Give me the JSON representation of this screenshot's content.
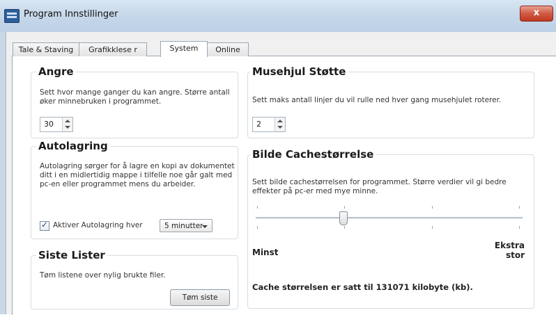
{
  "window": {
    "title": "Program Innstillinger",
    "close_label": "x"
  },
  "tabs": [
    {
      "label": "Tale & Staving"
    },
    {
      "label": "Grafikklese r"
    },
    {
      "label": "System"
    },
    {
      "label": "Online"
    }
  ],
  "active_tab": "System",
  "undo": {
    "title": "Angre",
    "description": "Sett hvor mange ganger du kan angre. Større antall øker minnebruken i programmet.",
    "value": "30"
  },
  "mousewheel": {
    "title": "Musehjul Støtte",
    "description": "Sett maks antall linjer du vil rulle ned hver gang musehjulet roterer.",
    "value": "2"
  },
  "autosave": {
    "title": "Autolagring",
    "description": "Autolagring sørger for å lagre en kopi av dokumentet ditt i en midlertidig mappe i tilfelle noe går galt med pc-en eller programmet mens du arbeider.",
    "checkbox_label": "Aktiver Autolagring hver",
    "checked": true,
    "interval": "5 minutter"
  },
  "cache": {
    "title": "Bilde Cachestørrelse",
    "description": "Sett bilde cachestørrelsen for programmet. Større verdier vil gi bedre effekter på pc-er med mye minne.",
    "min_label": "Minst",
    "max_label_1": "Ekstra",
    "max_label_2": "stor",
    "slider_position": 0.33,
    "status": "Cache størrelsen er satt til 131071 kilobyte (kb)."
  },
  "recent": {
    "title": "Siste Lister",
    "description": "Tøm listene over nylig brukte filer.",
    "button_label": "Tøm siste"
  }
}
